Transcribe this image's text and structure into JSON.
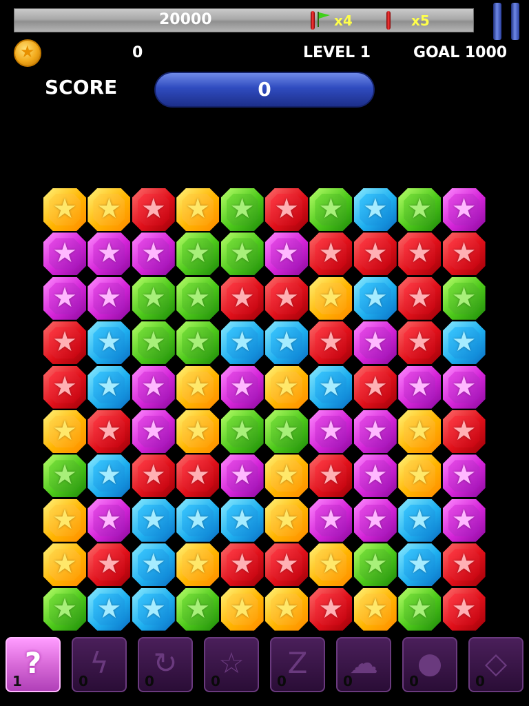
{
  "hud": {
    "high_score": "20000",
    "flag_mult": "x4",
    "stick_mult": "x5",
    "coins": "0",
    "level": "LEVEL  1",
    "goal": "GOAL 1000",
    "score_label": "SCORE",
    "score": "0"
  },
  "colors": {
    "Y": "yellow",
    "R": "red",
    "G": "green",
    "B": "blue",
    "P": "purple"
  },
  "board": [
    [
      "Y",
      "Y",
      "R",
      "Y",
      "G",
      "R",
      "G",
      "B",
      "G",
      "P"
    ],
    [
      "P",
      "P",
      "P",
      "G",
      "G",
      "P",
      "R",
      "R",
      "R",
      "R"
    ],
    [
      "P",
      "P",
      "G",
      "G",
      "R",
      "R",
      "Y",
      "B",
      "R",
      "G"
    ],
    [
      "R",
      "B",
      "G",
      "G",
      "B",
      "B",
      "R",
      "P",
      "R",
      "B"
    ],
    [
      "R",
      "B",
      "P",
      "Y",
      "P",
      "Y",
      "B",
      "R",
      "P",
      "P"
    ],
    [
      "Y",
      "R",
      "P",
      "Y",
      "G",
      "G",
      "P",
      "P",
      "Y",
      "R"
    ],
    [
      "G",
      "B",
      "R",
      "R",
      "P",
      "Y",
      "R",
      "P",
      "Y",
      "P"
    ],
    [
      "Y",
      "P",
      "B",
      "B",
      "B",
      "Y",
      "P",
      "P",
      "B",
      "P"
    ],
    [
      "Y",
      "R",
      "B",
      "Y",
      "R",
      "R",
      "Y",
      "G",
      "B",
      "R"
    ],
    [
      "G",
      "B",
      "B",
      "G",
      "Y",
      "Y",
      "R",
      "Y",
      "G",
      "R"
    ]
  ],
  "powerups": [
    {
      "icon": "question-icon",
      "symbol": "?",
      "count": "1",
      "active": true
    },
    {
      "icon": "lightning-icon",
      "symbol": "ϟ",
      "count": "0",
      "active": false
    },
    {
      "icon": "refresh-icon",
      "symbol": "↻",
      "count": "0",
      "active": false
    },
    {
      "icon": "star-icon",
      "symbol": "☆",
      "count": "0",
      "active": false
    },
    {
      "icon": "zigzag-icon",
      "symbol": "Z",
      "count": "0",
      "active": false
    },
    {
      "icon": "cloud-icon",
      "symbol": "☁",
      "count": "0",
      "active": false
    },
    {
      "icon": "bomb-icon",
      "symbol": "●",
      "count": "0",
      "active": false
    },
    {
      "icon": "diamond-icon",
      "symbol": "◇",
      "count": "0",
      "active": false
    }
  ]
}
